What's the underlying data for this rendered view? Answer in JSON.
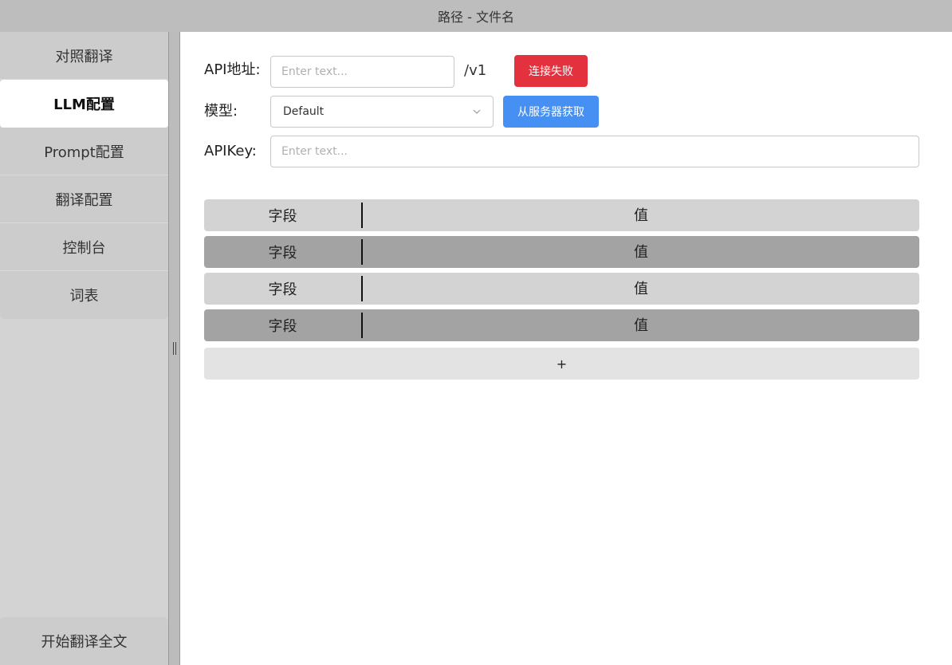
{
  "window": {
    "title": "路径 - 文件名"
  },
  "sidebar": {
    "items": [
      {
        "label": "对照翻译",
        "active": false
      },
      {
        "label": "LLM配置",
        "active": true
      },
      {
        "label": "Prompt配置",
        "active": false
      },
      {
        "label": "翻译配置",
        "active": false
      },
      {
        "label": "控制台",
        "active": false
      },
      {
        "label": "词表",
        "active": false
      }
    ],
    "start_button": "开始翻译全文"
  },
  "form": {
    "api_label": "API地址:",
    "api_placeholder": "Enter text...",
    "api_value": "",
    "api_suffix": "/v1",
    "connect_status": "连接失败",
    "model_label": "模型:",
    "model_selected": "Default",
    "fetch_button": "从服务器获取",
    "apikey_label": "APIKey:",
    "apikey_placeholder": "Enter text...",
    "apikey_value": ""
  },
  "params_table": {
    "rows": [
      {
        "field": "字段",
        "value": "值"
      },
      {
        "field": "字段",
        "value": "值"
      },
      {
        "field": "字段",
        "value": "值"
      },
      {
        "field": "字段",
        "value": "值"
      }
    ],
    "add_label": "+"
  },
  "colors": {
    "status_fail": "#e3313d",
    "primary_blue": "#4690f3",
    "titlebar": "#bdbdbd",
    "sidebar": "#d3d3d3"
  },
  "icons": {
    "select_arrow": "chevron-down-icon",
    "splitter_grip": "grip-vertical-icon"
  }
}
